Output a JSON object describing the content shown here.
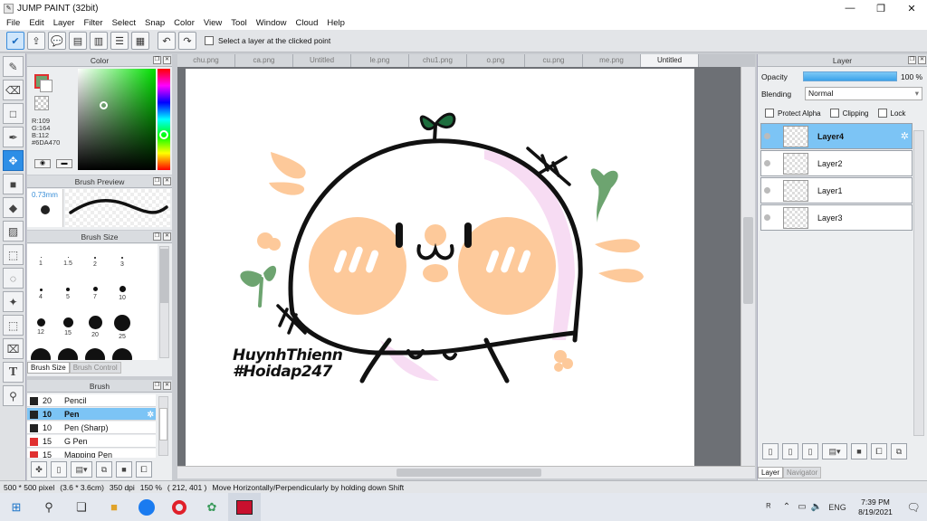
{
  "window": {
    "title": "JUMP PAINT (32bit)",
    "minimize": "—",
    "maximize": "❐",
    "close": "✕"
  },
  "menu": [
    "File",
    "Edit",
    "Layer",
    "Filter",
    "Select",
    "Snap",
    "Color",
    "View",
    "Tool",
    "Window",
    "Cloud",
    "Help"
  ],
  "toolbar": {
    "select_layer_label": "Select a layer at the clicked point"
  },
  "color_panel": {
    "title": "Color",
    "r": "R:109",
    "g": "G:164",
    "b": "B:112",
    "hex": "#6DA470",
    "current_color": "#6DA470",
    "secondary_color": "#ffffff"
  },
  "brush_preview": {
    "title": "Brush Preview",
    "size": "0.73mm"
  },
  "brush_size": {
    "title": "Brush Size",
    "rows": [
      [
        "1",
        "1.5",
        "2",
        "3"
      ],
      [
        "4",
        "5",
        "7",
        "10"
      ],
      [
        "12",
        "15",
        "20",
        "25"
      ]
    ],
    "tab_active": "Brush Size",
    "tab_inactive": "Brush Control"
  },
  "brush_panel": {
    "title": "Brush",
    "items": [
      {
        "size": "20",
        "name": "Pencil",
        "color": "#222222"
      },
      {
        "size": "10",
        "name": "Pen",
        "color": "#222222"
      },
      {
        "size": "10",
        "name": "Pen (Sharp)",
        "color": "#222222"
      },
      {
        "size": "15",
        "name": "G Pen",
        "color": "#e03030"
      },
      {
        "size": "15",
        "name": "Mapping Pen",
        "color": "#e03030"
      }
    ]
  },
  "tabs": [
    "chu.png",
    "ca.png",
    "Untitled",
    "le.png",
    "chu1.png",
    "o.png",
    "cu.png",
    "me.png",
    "Untitled"
  ],
  "active_tab_index": 8,
  "canvas": {
    "watermark_line1": "HuynhThienn",
    "watermark_line2": "#Hoidap247"
  },
  "layer_panel": {
    "title": "Layer",
    "opacity_label": "Opacity",
    "opacity_value": "100 %",
    "blending_label": "Blending",
    "blending_value": "Normal",
    "protect_alpha": "Protect Alpha",
    "clipping": "Clipping",
    "lock": "Lock",
    "layers": [
      "Layer4",
      "Layer2",
      "Layer1",
      "Layer3"
    ],
    "active_layer": "Layer4",
    "tab_layer": "Layer",
    "tab_navigator": "Navigator"
  },
  "status": {
    "canvas_size": "500 * 500 pixel",
    "physical_size": "(3.6 * 3.6cm)",
    "dpi": "350 dpi",
    "zoom": "150 %",
    "cursor": "( 212, 401 )",
    "hint": "Move Horizontally/Perpendicularly by holding down Shift"
  },
  "taskbar": {
    "language": "ENG",
    "time": "7:39 PM",
    "date": "8/19/2021"
  }
}
